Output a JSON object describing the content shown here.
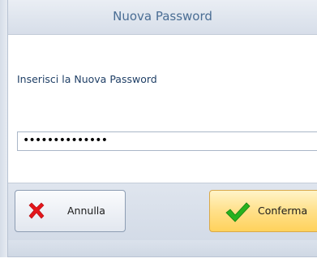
{
  "dialog": {
    "title": "Nuova Password",
    "prompt": "Inserisci la Nuova Password",
    "password_field": {
      "masked_value": "••••••••••••••"
    },
    "buttons": {
      "cancel_label": "Annulla",
      "cancel_icon": "red-x-icon",
      "confirm_label": "Conferma",
      "confirm_icon": "green-check-icon"
    }
  },
  "colors": {
    "title_text": "#4a6d94",
    "prompt_text": "#1f3f66",
    "confirm_bg": "#ffe08a",
    "cancel_icon": "#e4161b",
    "confirm_icon": "#27b11f"
  }
}
